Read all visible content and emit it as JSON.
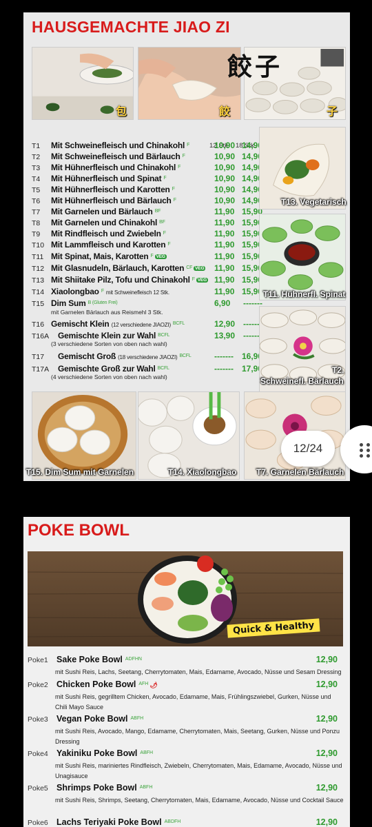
{
  "jiaozi": {
    "title": "HAUSGEMACHTE JIAO ZI",
    "top_images": {
      "chars": [
        "包",
        "餃",
        "子"
      ],
      "calligraphy": "餃子"
    },
    "col_12": "12 Stk.",
    "col_18": "18 Stk.",
    "items": [
      {
        "code": "T1",
        "name": "Mit Schweinefleisch und Chinakohl",
        "tag": "F",
        "p12": "10,90",
        "p18": "14,90"
      },
      {
        "code": "T2",
        "name": "Mit Schweinefleisch und Bärlauch",
        "tag": "F",
        "p12": "10,90",
        "p18": "14,90"
      },
      {
        "code": "T3",
        "name": "Mit Hühnerfleisch und Chinakohl",
        "tag": "F",
        "p12": "10,90",
        "p18": "14,90"
      },
      {
        "code": "T4",
        "name": "Mit Hühnerfleisch und Spinat",
        "tag": "F",
        "p12": "10,90",
        "p18": "14,90"
      },
      {
        "code": "T5",
        "name": "Mit Hühnerfleisch und Karotten",
        "tag": "F",
        "p12": "10,90",
        "p18": "14,90"
      },
      {
        "code": "T6",
        "name": "Mit Hühnerfleisch und Bärlauch",
        "tag": "F",
        "p12": "10,90",
        "p18": "14,90"
      },
      {
        "code": "T7",
        "name": "Mit Garnelen und Bärlauch",
        "tag": "BF",
        "p12": "11,90",
        "p18": "15,90"
      },
      {
        "code": "T8",
        "name": "Mit Garnelen und Chinakohl",
        "tag": "BF",
        "p12": "11,90",
        "p18": "15,90"
      },
      {
        "code": "T9",
        "name": "Mit Rindfleisch und Zwiebeln",
        "tag": "F",
        "p12": "11,90",
        "p18": "15,90"
      },
      {
        "code": "T10",
        "name": "Mit Lammfleisch und Karotten",
        "tag": "F",
        "p12": "11,90",
        "p18": "15,90"
      },
      {
        "code": "T11",
        "name": "Mit Spinat, Mais, Karotten",
        "tag": "F",
        "veg": "VEG",
        "p12": "11,90",
        "p18": "15,90"
      },
      {
        "code": "T12",
        "name": "Mit Glasnudeln, Bärlauch, Karotten",
        "tag": "CF",
        "veg": "VEG",
        "p12": "11,90",
        "p18": "15,90"
      },
      {
        "code": "T13",
        "name": "Mit Shiitake Pilz, Tofu und Chinakohl",
        "tag": "F",
        "veg": "VEG",
        "p12": "11,90",
        "p18": "15,90"
      },
      {
        "code": "T14",
        "name": "Xiaolongbao",
        "tag": "F",
        "note": "mit Schweinefleisch 12 Stk.",
        "p12": "11,90",
        "p18": "15,90"
      }
    ],
    "t15": {
      "code": "T15",
      "name": "Dim Sum",
      "tag": "B (Gluten Frei)",
      "sub": "mit Garnelen Bärlauch aus Reismehl 3 Stk.",
      "p12": "6,90",
      "p18": "-------"
    },
    "t16": {
      "code": "T16",
      "name": "Gemischt Klein",
      "note": "(12 verschiedene JIAOZI)",
      "tag": "BCFL",
      "p12": "12,90",
      "p18": "-------"
    },
    "t16a": {
      "code": "T16A",
      "name": "Gemischte Klein zur Wahl",
      "tag": "BCFL",
      "sub": "(3 verschiedene Sorten von oben nach wahl)",
      "p12": "13,90",
      "p18": "-------"
    },
    "t17": {
      "code": "T17",
      "name": "Gemischt Groß",
      "note": "(18 verschiedene JIAOZI)",
      "tag": "BCFL",
      "p12": "-------",
      "p18": "16,90"
    },
    "t17a": {
      "code": "T17A",
      "name": "Gemischte Groß zur Wahl",
      "tag": "BCFL",
      "sub": "(4 verschiedene Sorten von oben nach wahl)",
      "p12": "-------",
      "p18": "17,90"
    },
    "side_captions": [
      "T13. Vegetarisch",
      "T11. Hühnerfl. Spinat",
      "T2.",
      "Schweinefl. Bärlauch"
    ],
    "bottom_captions": [
      "T15. Dim Sum mit Garnelen",
      "T14. Xiaolongbao",
      "T7. Garnelen Bärlauch"
    ]
  },
  "pager": {
    "label": "12/24"
  },
  "poke": {
    "title": "POKE BOWL",
    "banner": "Quick & Healthy",
    "items": [
      {
        "code": "Poke1",
        "name": "Sake Poke Bowl",
        "tag": "ADFHN",
        "price": "12,90",
        "desc": "mit Sushi Reis, Lachs, Seetang, Cherrytomaten, Mais, Edamame, Avocado, Nüsse und Sesam Dressing"
      },
      {
        "code": "Poke2",
        "name": "Chicken Poke Bowl",
        "tag": "AFH",
        "chili": "🌶",
        "price": "12,90",
        "desc": "mit Sushi Reis, gegrilltem Chicken, Avocado, Edamame, Mais, Frühlingszwiebel, Gurken, Nüsse und Chili Mayo Sauce"
      },
      {
        "code": "Poke3",
        "name": "Vegan Poke Bowl",
        "tag": "ABFH",
        "price": "12,90",
        "desc": "mit Sushi Reis, Avocado, Mango, Edamame, Cherrytomaten, Mais, Seetang, Gurken, Nüsse und Ponzu Dressing"
      },
      {
        "code": "Poke4",
        "name": "Yakiniku Poke Bowl",
        "tag": "ABFH",
        "price": "12,90",
        "desc": "mit Sushi Reis, mariniertes Rindfleisch, Zwiebeln, Cherrytomaten, Mais, Edamame, Avocado, Nüsse und Unagisauce"
      },
      {
        "code": "Poke5",
        "name": "Shrimps Poke Bowl",
        "tag": "ABFH",
        "price": "12,90",
        "desc": "mit Sushi Reis, Shrimps, Seetang, Cherrytomaten, Mais, Edamame, Avocado, Nüsse und Cocktail Sauce"
      },
      {
        "code": "Poke6",
        "name": "Lachs Teriyaki Poke Bowl",
        "tag": "ABDFH",
        "price": "12,90",
        "desc": ""
      }
    ]
  }
}
